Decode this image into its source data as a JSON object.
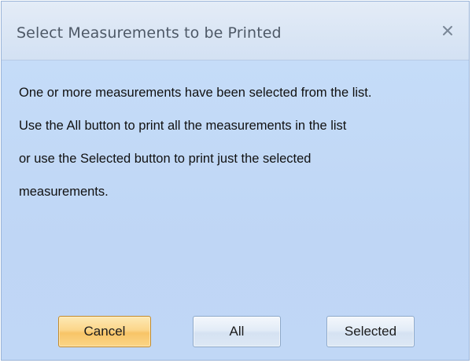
{
  "dialog": {
    "title": "Select Measurements to be Printed",
    "close_glyph": "X",
    "message_lines": [
      "One or more measurements have been selected from the list.",
      "Use the All button to print all the measurements in the list",
      "or use the Selected button to print just the selected",
      "measurements."
    ],
    "buttons": {
      "cancel": "Cancel",
      "all": "All",
      "selected": "Selected"
    }
  },
  "colors": {
    "title_bar": "#dce7f5",
    "body": "#c3d9f5",
    "title_text": "#4e5967",
    "cancel_button": "#fbd68a",
    "normal_button": "#e3ecf7"
  },
  "icons": {
    "close": "close-icon"
  }
}
